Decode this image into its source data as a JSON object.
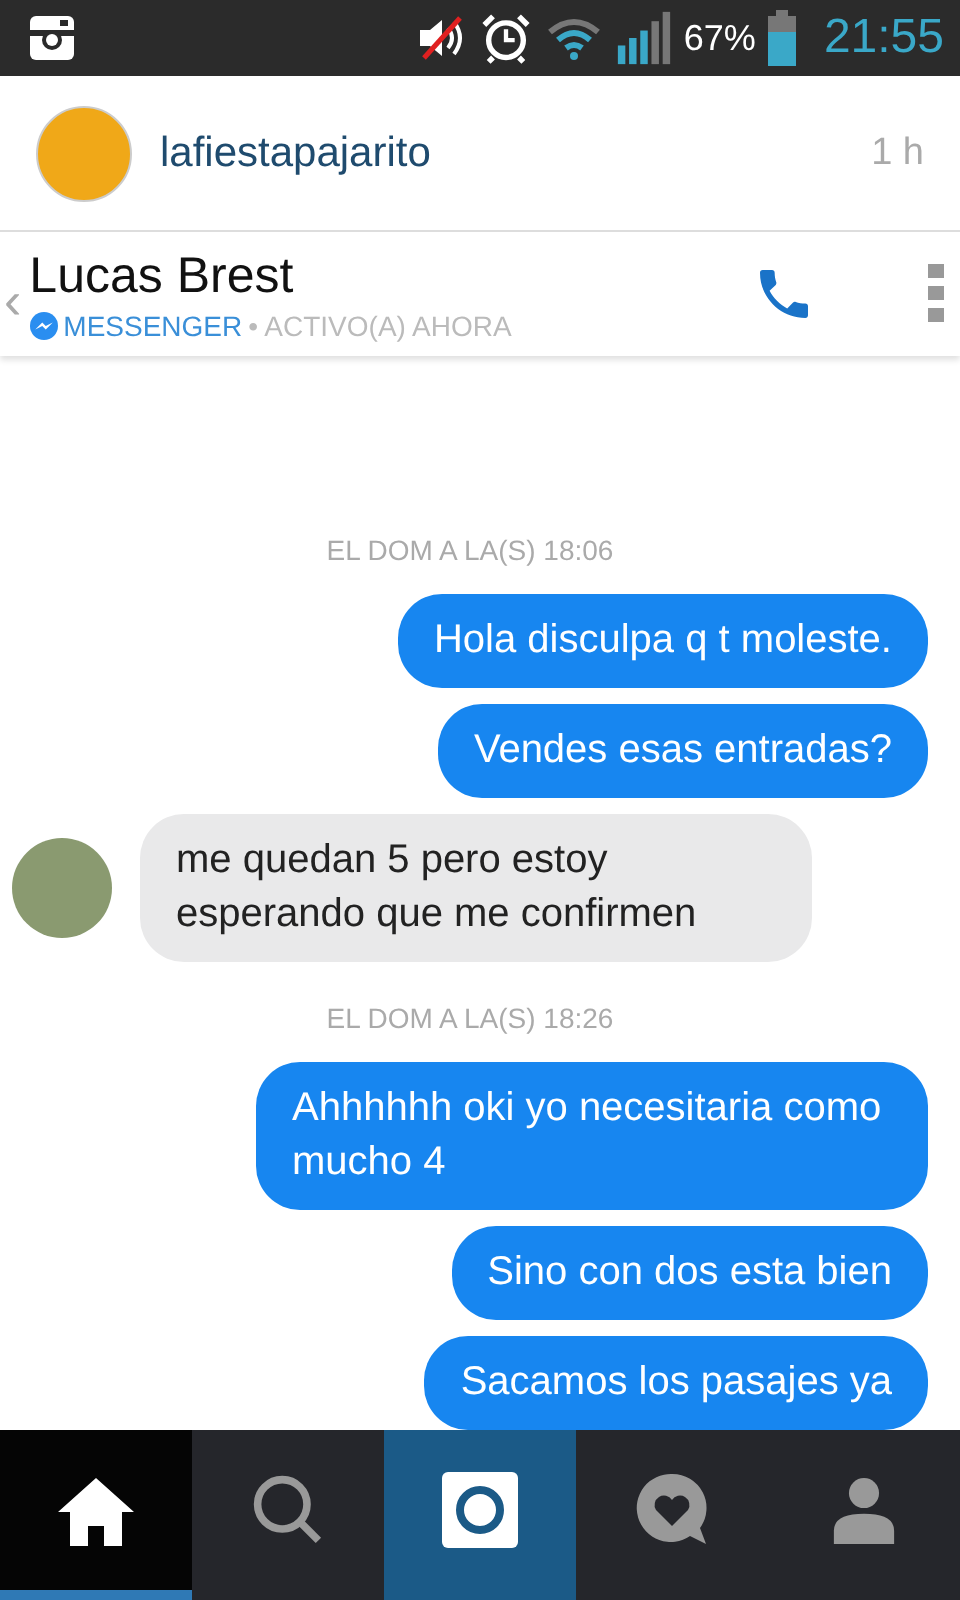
{
  "status_bar": {
    "battery": "67%",
    "time": "21:55"
  },
  "post_header": {
    "username": "lafiestapajarito",
    "time": "1 h"
  },
  "chat_header": {
    "back": "‹",
    "name": "Lucas Brest",
    "source": "MESSENGER",
    "status": "• ACTIVO(A) AHORA"
  },
  "messages": [
    {
      "kind": "timestamp",
      "text": "EL DOM A LA(S) 18:06"
    },
    {
      "kind": "outgoing",
      "text": "Hola disculpa q t moleste."
    },
    {
      "kind": "outgoing",
      "text": "Vendes esas entradas?"
    },
    {
      "kind": "incoming",
      "text": "me quedan 5 pero estoy esperando que me confirmen"
    },
    {
      "kind": "timestamp",
      "text": "EL DOM A LA(S) 18:26"
    },
    {
      "kind": "outgoing",
      "text": "Ahhhhhh oki yo necesitaria como mucho 4"
    },
    {
      "kind": "outgoing",
      "text": "Sino con dos esta bien"
    },
    {
      "kind": "outgoing",
      "text": "Sacamos los pasajes ya"
    }
  ],
  "nav": [
    {
      "kind": "home",
      "selected": true
    },
    {
      "kind": "search",
      "selected": false
    },
    {
      "kind": "camera",
      "selected": false
    },
    {
      "kind": "activity",
      "selected": false
    },
    {
      "kind": "profile",
      "selected": false
    }
  ]
}
